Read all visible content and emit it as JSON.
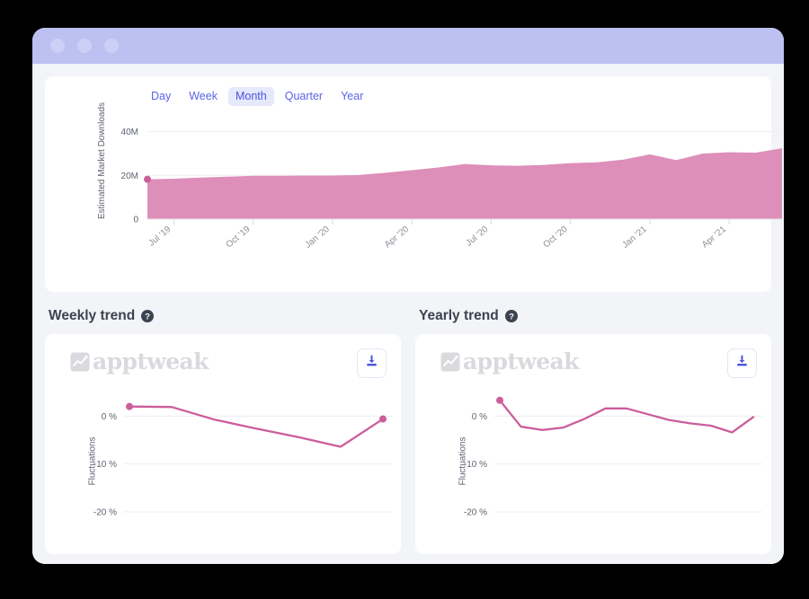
{
  "window": {
    "dots": [
      "window-dot-1",
      "window-dot-2",
      "window-dot-3"
    ]
  },
  "market_card": {
    "granularity_tabs": [
      {
        "label": "Day",
        "active": false
      },
      {
        "label": "Week",
        "active": false
      },
      {
        "label": "Month",
        "active": true
      },
      {
        "label": "Quarter",
        "active": false
      },
      {
        "label": "Year",
        "active": false
      }
    ]
  },
  "trends": {
    "weekly": {
      "heading": "Weekly trend",
      "help_icon": "help-circle-icon",
      "watermark_text": "apptweak",
      "watermark_icon": "apptweak-chart-mark-icon",
      "download_icon": "download-icon"
    },
    "yearly": {
      "heading": "Yearly trend",
      "help_icon": "help-circle-icon",
      "watermark_text": "apptweak",
      "watermark_icon": "apptweak-chart-mark-icon",
      "download_icon": "download-icon"
    }
  },
  "colors": {
    "title_bar": "#bcc1f2",
    "page_bg": "#f2f4f8",
    "card_bg": "#ffffff",
    "accent_indigo": "#5b63e8",
    "tab_active_bg": "#e6e8fb",
    "area_fill": "#dd8fb9",
    "line_stroke": "#cc5d9c",
    "watermark_gray": "#d9dadd",
    "grid": "#eeeef2"
  },
  "chart_data": [
    {
      "id": "estimated-market-downloads",
      "type": "area",
      "title": "",
      "xlabel": "",
      "ylabel": "Estimated Market Downloads",
      "ytick_labels": [
        "0",
        "20M",
        "40M"
      ],
      "ytick_values": [
        0,
        20000000,
        40000000
      ],
      "ylim": [
        0,
        46000000
      ],
      "xtick_labels": [
        "Jul '19",
        "Oct '19",
        "Jan '20",
        "Apr '20",
        "Jul '20",
        "Oct '20",
        "Jan '21",
        "Apr '21"
      ],
      "grid": true,
      "legend": "none",
      "x": [
        "Jun '19",
        "Jul '19",
        "Aug '19",
        "Sep '19",
        "Oct '19",
        "Nov '19",
        "Dec '19",
        "Jan '20",
        "Feb '20",
        "Mar '20",
        "Apr '20",
        "May '20",
        "Jun '20",
        "Jul '20",
        "Aug '20",
        "Sep '20",
        "Oct '20",
        "Nov '20",
        "Dec '20",
        "Jan '21",
        "Feb '21",
        "Mar '21",
        "Apr '21",
        "May '21",
        "Jun '21"
      ],
      "values": [
        18.2,
        18.5,
        19.0,
        19.4,
        19.8,
        19.8,
        19.9,
        19.9,
        20.2,
        21.2,
        22.4,
        23.6,
        25.2,
        24.6,
        24.4,
        24.8,
        25.6,
        26.0,
        27.2,
        29.6,
        27.0,
        30.0,
        30.6,
        30.4,
        32.4
      ],
      "unit": "M",
      "marker_points": [
        {
          "index": 0,
          "value": 18.2
        }
      ]
    },
    {
      "id": "weekly-trend",
      "type": "line",
      "title": "Weekly trend",
      "xlabel": "",
      "ylabel": "Fluctuations",
      "ytick_labels": [
        "0 %",
        "-10 %",
        "-20 %"
      ],
      "ytick_values": [
        0,
        -10,
        -20
      ],
      "ylim": [
        -23,
        4
      ],
      "grid": true,
      "legend": "none",
      "x": [
        0,
        1,
        2,
        3,
        4,
        5,
        6
      ],
      "values": [
        2.0,
        1.9,
        -0.7,
        -2.6,
        -4.4,
        -6.4,
        -0.6
      ],
      "unit": "%",
      "marker_points": [
        {
          "index": 0,
          "value": 2.0
        },
        {
          "index": 6,
          "value": -0.6
        }
      ]
    },
    {
      "id": "yearly-trend",
      "type": "line",
      "title": "Yearly trend",
      "xlabel": "",
      "ylabel": "Fluctuations",
      "ytick_labels": [
        "0 %",
        "-10 %",
        "-20 %"
      ],
      "ytick_values": [
        0,
        -10,
        -20
      ],
      "ylim": [
        -23,
        4
      ],
      "grid": true,
      "legend": "none",
      "x": [
        0,
        1,
        2,
        3,
        4,
        5,
        6,
        7,
        8,
        9,
        10,
        11,
        12
      ],
      "values": [
        3.3,
        -2.2,
        -2.9,
        -2.4,
        -0.6,
        1.6,
        1.6,
        0.4,
        -0.8,
        -1.5,
        -2.0,
        -3.4,
        -0.2
      ],
      "unit": "%",
      "marker_points": [
        {
          "index": 0,
          "value": 3.3
        }
      ]
    }
  ]
}
